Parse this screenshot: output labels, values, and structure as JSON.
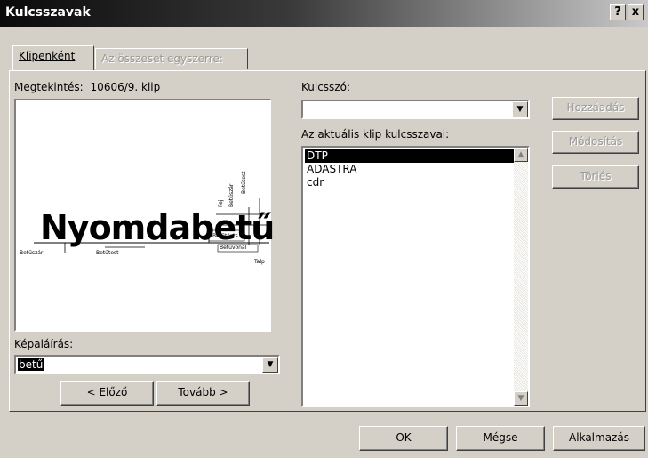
{
  "window": {
    "title": "Kulcsszavak",
    "help_glyph": "?",
    "close_glyph": "x"
  },
  "tabs": [
    {
      "label": "Klipenként",
      "active": true
    },
    {
      "label": "Az összeset egyszerre:",
      "active": false
    }
  ],
  "preview": {
    "label": "Megtekintés:",
    "clip_name": "10606/9. klip",
    "image_text": "Nyomdabetű",
    "annotations": [
      "Betűszár",
      "Betűtest",
      "Betűtörzs",
      "Betűvonal",
      "Fej",
      "Talp"
    ]
  },
  "caption": {
    "label": "Képaláírás:",
    "value": "betű"
  },
  "nav": {
    "prev_label": "< Előző",
    "next_label": "Tovább >"
  },
  "keyword": {
    "label": "Kulcsszó:",
    "value": ""
  },
  "current_keywords": {
    "label": "Az aktuális klip kulcsszavai:",
    "items": [
      "DTP",
      "ADASTRA",
      "cdr"
    ],
    "selected_index": 0
  },
  "side_buttons": {
    "add_label": "Hozzáadás",
    "modify_label": "Módosítás",
    "delete_label": "Törlés"
  },
  "footer": {
    "ok_label": "OK",
    "cancel_label": "Mégse",
    "apply_label": "Alkalmazás"
  },
  "icons": {
    "dropdown": "chevron-down-icon",
    "scroll_up": "arrow-up-icon",
    "scroll_down": "arrow-down-icon"
  },
  "colors": {
    "face": "#d4d0c8",
    "selection": "#000000",
    "window_bg": "#ffffff"
  }
}
